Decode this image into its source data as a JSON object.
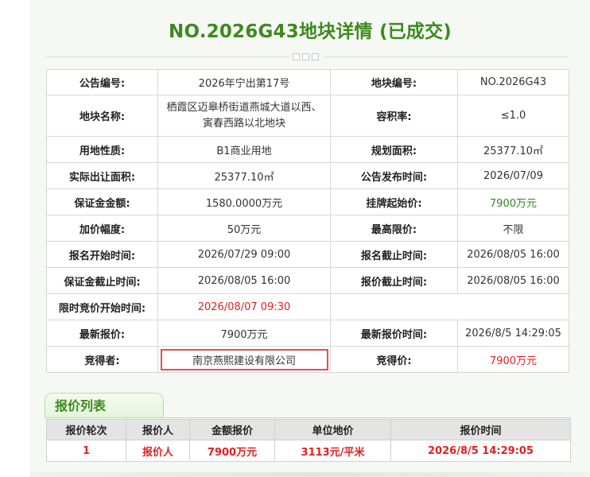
{
  "header": {
    "title": "NO.2026G43地块详情 (已成交)"
  },
  "details": [
    {
      "l1": "公告编号:",
      "v1": "2026年宁出第17号",
      "l2": "地块编号:",
      "v2": "NO.2026G43"
    },
    {
      "l1": "地块名称:",
      "v1": "栖霞区迈皋桥街道燕城大道以西、寅春西路以北地块",
      "l2": "容积率:",
      "v2": "≤1.0"
    },
    {
      "l1": "用地性质:",
      "v1": "B1商业用地",
      "l2": "规划面积:",
      "v2": "25377.10㎡"
    },
    {
      "l1": "实际出让面积:",
      "v1": "25377.10㎡",
      "l2": "公告发布时间:",
      "v2": "2026/07/09"
    },
    {
      "l1": "保证金金额:",
      "v1": "1580.0000万元",
      "l2": "挂牌起始价:",
      "v2": "7900万元"
    },
    {
      "l1": "加价幅度:",
      "v1": "50万元",
      "l2": "最高限价:",
      "v2": "不限"
    },
    {
      "l1": "报名开始时间:",
      "v1": "2026/07/29 09:00",
      "l2": "报名截止时间:",
      "v2": "2026/08/05 16:00"
    },
    {
      "l1": "保证金截止时间:",
      "v1": "2026/08/05 16:00",
      "l2": "报价截止时间:",
      "v2": "2026/08/05 16:00"
    },
    {
      "l1": "限时竞价开始时间:",
      "v1": "2026/08/07 09:30",
      "l2": "",
      "v2": ""
    },
    {
      "l1": "最新报价:",
      "v1": "7900万元",
      "l2": "最新报价时间:",
      "v2": "2026/8/5 14:29:05"
    },
    {
      "l1": "竞得者:",
      "v1": "南京燕熙建设有限公司",
      "l2": "竞得价:",
      "v2": "7900万元"
    }
  ],
  "bids_section": {
    "tab_label": "报价列表",
    "headers": [
      "报价轮次",
      "报价人",
      "金额报价",
      "单位地价",
      "报价时间"
    ],
    "rows": [
      [
        "1",
        "报价人",
        "7900万元",
        "3113元/平米",
        "2026/8/5 14:29:05"
      ]
    ]
  },
  "colors": {
    "accent_green": "#3d8a1f",
    "price_green": "#2f8a1e",
    "alert_red": "#e02020"
  }
}
